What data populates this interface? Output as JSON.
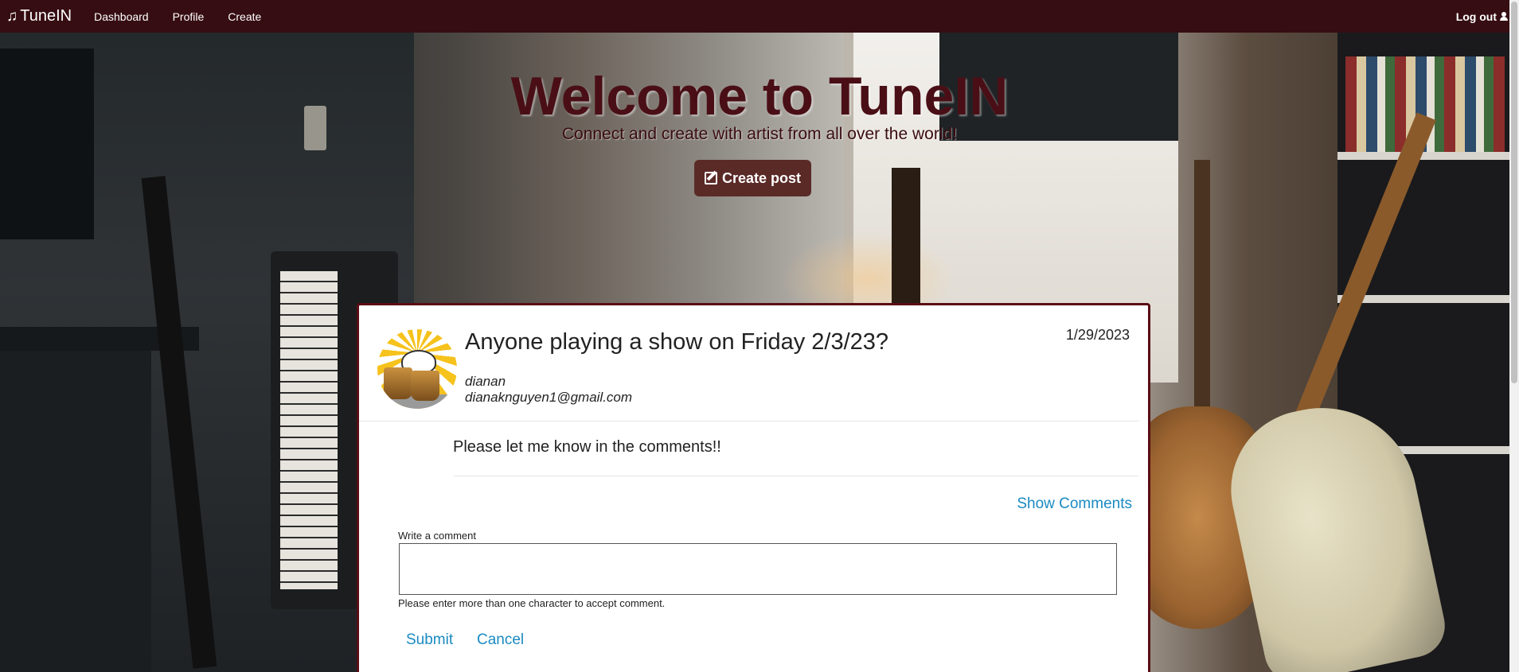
{
  "navbar": {
    "brand": "TuneIN",
    "links": [
      "Dashboard",
      "Profile",
      "Create"
    ],
    "logout": "Log out"
  },
  "hero": {
    "title": "Welcome to TuneIN",
    "subtitle": "Connect and create with artist from all over the world!",
    "create_button": "Create post"
  },
  "post": {
    "title": "Anyone playing a show on Friday 2/3/23?",
    "date": "1/29/2023",
    "username": "dianan",
    "email": "dianaknguyen1@gmail.com",
    "body": "Please let me know in the comments!!",
    "show_comments": "Show Comments"
  },
  "comment_form": {
    "label": "Write a comment",
    "value": "",
    "help": "Please enter more than one character to accept comment.",
    "submit": "Submit",
    "cancel": "Cancel"
  },
  "colors": {
    "navbar": "#360d12",
    "accent_link": "#1a8ac2",
    "create_button": "#5a2a27",
    "card_border": "#5a0d14"
  }
}
